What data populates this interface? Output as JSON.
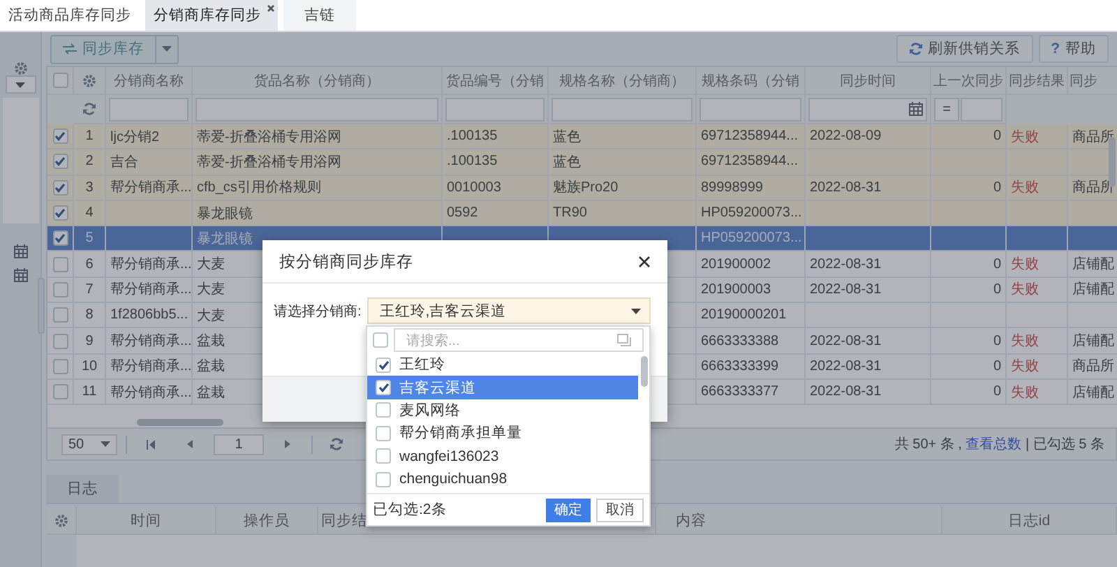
{
  "tabs": [
    {
      "label": "活动商品库存同步",
      "selected": false
    },
    {
      "label": "分销商库存同步",
      "selected": true
    },
    {
      "label": "吉链",
      "selected": false
    }
  ],
  "toolbar": {
    "sync_button": "同步库存",
    "refresh_button": "刷新供销关系",
    "help_icon": "?",
    "help_button": "帮助"
  },
  "grid": {
    "columns": [
      "分销商名称",
      "货品名称（分销商）",
      "货品编号（分销",
      "规格名称（分销商）",
      "规格条码（分销",
      "同步时间",
      "上一次同步",
      "同步结果",
      "同步"
    ],
    "select_all_checked": false,
    "filter_operator": "=",
    "rows": [
      {
        "number": "1",
        "checked": true,
        "selected": false,
        "distributor": "ljc分销2",
        "goods_name": "蒂爱-折叠浴桶专用浴网",
        "goods_code": ".100135",
        "spec_name": "蓝色",
        "spec_barcode": "69712358944...",
        "sync_time": "2022-08-09",
        "last_sync": "0",
        "sync_result": "失败",
        "sync_note": "商品所"
      },
      {
        "number": "2",
        "checked": true,
        "selected": false,
        "distributor": "吉合",
        "goods_name": "蒂爱-折叠浴桶专用浴网",
        "goods_code": ".100135",
        "spec_name": "蓝色",
        "spec_barcode": "69712358944..."
      },
      {
        "number": "3",
        "checked": true,
        "selected": false,
        "distributor": "帮分销商承...",
        "goods_name": "cfb_cs引用价格规则",
        "goods_code": "0010003",
        "spec_name": "魅族Pro20",
        "spec_barcode": "89998999",
        "sync_time": "2022-08-31",
        "last_sync": "0",
        "sync_result": "失败",
        "sync_note": "商品所"
      },
      {
        "number": "4",
        "checked": true,
        "selected": false,
        "goods_name": "暴龙眼镜",
        "goods_code": "0592",
        "spec_name": "TR90",
        "spec_barcode": "HP059200073..."
      },
      {
        "number": "5",
        "checked": true,
        "selected": true,
        "goods_name": "暴龙眼镜",
        "spec_barcode": "HP059200073..."
      },
      {
        "number": "6",
        "checked": false,
        "selected": false,
        "distributor": "帮分销商承...",
        "goods_name": "大麦",
        "spec_barcode": "201900002",
        "sync_time": "2022-08-31",
        "last_sync": "0",
        "sync_result": "失败",
        "sync_note": "店铺配"
      },
      {
        "number": "7",
        "checked": false,
        "selected": false,
        "distributor": "帮分销商承...",
        "goods_name": "大麦",
        "spec_barcode": "201900003",
        "sync_time": "2022-08-31",
        "last_sync": "0",
        "sync_result": "失败",
        "sync_note": "店铺配"
      },
      {
        "number": "8",
        "checked": false,
        "selected": false,
        "distributor": "1f2806bb5...",
        "goods_name": "大麦",
        "spec_barcode": "20190000201"
      },
      {
        "number": "9",
        "checked": false,
        "selected": false,
        "distributor": "帮分销商承...",
        "goods_name": "盆栽",
        "spec_barcode": "6663333388",
        "sync_time": "2022-08-31",
        "last_sync": "0",
        "sync_result": "失败",
        "sync_note": "店铺配"
      },
      {
        "number": "10",
        "checked": false,
        "selected": false,
        "distributor": "帮分销商承...",
        "goods_name": "盆栽",
        "spec_barcode": "6663333399",
        "sync_time": "2022-08-31",
        "last_sync": "0",
        "sync_result": "失败",
        "sync_note": "商品所"
      },
      {
        "number": "11",
        "checked": false,
        "selected": false,
        "distributor": "帮分销商承...",
        "goods_name": "盆栽",
        "spec_barcode": "6663333377",
        "sync_time": "2022-08-31",
        "last_sync": "0",
        "sync_result": "失败",
        "sync_note": "店铺配"
      }
    ]
  },
  "pager": {
    "page_size": "50",
    "page": "1",
    "summary": "共 50+ 条 , ",
    "total_link": "查看总数",
    "selection": " | 已勾选 5 条"
  },
  "log": {
    "tab": "日志",
    "columns": [
      "时间",
      "操作员",
      "同步结",
      "内容",
      "日志id"
    ]
  },
  "dialog": {
    "title": "按分销商同步库存",
    "field_label": "请选择分销商:",
    "field_value": "王红玲,吉客云渠道"
  },
  "picker": {
    "select_all_checked": false,
    "placeholder": "请搜索...",
    "items": [
      {
        "label": "王红玲",
        "checked": true,
        "selected": false
      },
      {
        "label": "吉客云渠道",
        "checked": true,
        "selected": true
      },
      {
        "label": "麦风网络",
        "checked": false,
        "selected": false
      },
      {
        "label": "帮分销商承担单量",
        "checked": false,
        "selected": false
      },
      {
        "label": "wangfei136023",
        "checked": false,
        "selected": false
      },
      {
        "label": "chenguichuan98",
        "checked": false,
        "selected": false
      }
    ],
    "selected_count": "已勾选:2条",
    "ok_button": "确定",
    "cancel_button": "取消"
  }
}
